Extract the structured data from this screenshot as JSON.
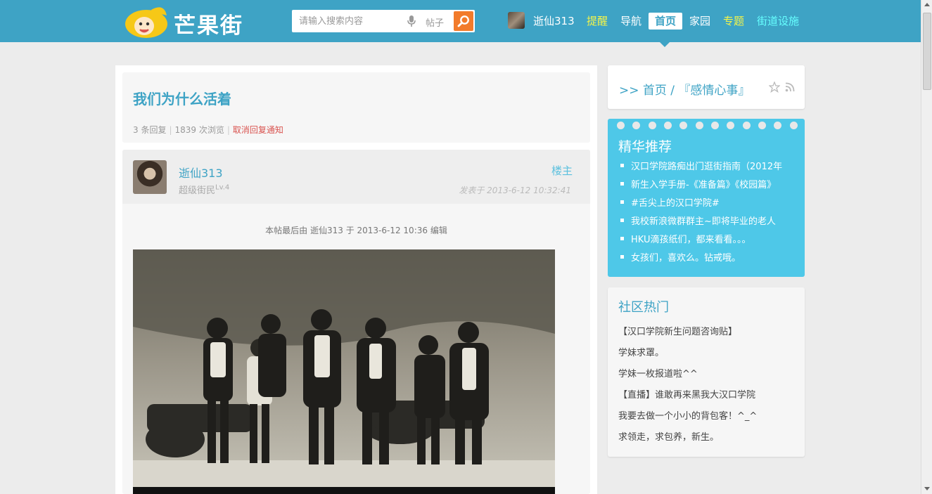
{
  "header": {
    "logo_text": "芒果街",
    "search_placeholder": "请输入搜索内容",
    "search_scope": "帖子",
    "user": "逝仙313",
    "nav": [
      {
        "label": "提醒",
        "color": "#f4f44a"
      },
      {
        "label": "导航",
        "color": "#ffffff"
      },
      {
        "label": "首页",
        "color": "#3ea3c5"
      },
      {
        "label": "家园",
        "color": "#ffffff"
      },
      {
        "label": "专题",
        "color": "#f4f44a"
      },
      {
        "label": "街道设施",
        "color": "#66ffff"
      }
    ]
  },
  "thread": {
    "title": "我们为什么活着",
    "replies": "3 条回复",
    "views": "1839 次浏览",
    "cancel_notify": "取消回复通知"
  },
  "post": {
    "author": "逝仙313",
    "rank": "超级街民",
    "level": "Lv.4",
    "floor_tag": "楼主",
    "time": "发表于 2013-6-12 10:32:41",
    "edit_note": "本帖最后由 逝仙313 于 2013-6-12 10:36 编辑"
  },
  "sidebar": {
    "breadcrumb": ">> 首页 / 『感情心事』",
    "featured_title": "精华推荐",
    "featured": [
      "汉口学院路痴出门逛街指南（2012年",
      "新生入学手册-《准备篇》《校园篇》",
      "#舌尖上的汉口学院#",
      "我校新浪微群群主~即将毕业的老人",
      "HKU滴孩纸们，都来看看。。。",
      "女孩们，喜欢么。钻戒哦。"
    ],
    "hot_title": "社区热门",
    "hot": [
      "【汉口学院新生问题咨询贴】",
      "学妹求罩。",
      "学妹一枚报道啦^^",
      "【直播】谁敢再来黑我大汉口学院",
      "我要去做一个小小的背包客！^_^",
      "求领走，求包养，新生。"
    ]
  },
  "icons": {
    "mic": "microphone-icon",
    "search": "search-icon",
    "star": "star-icon",
    "rss": "rss-icon"
  }
}
